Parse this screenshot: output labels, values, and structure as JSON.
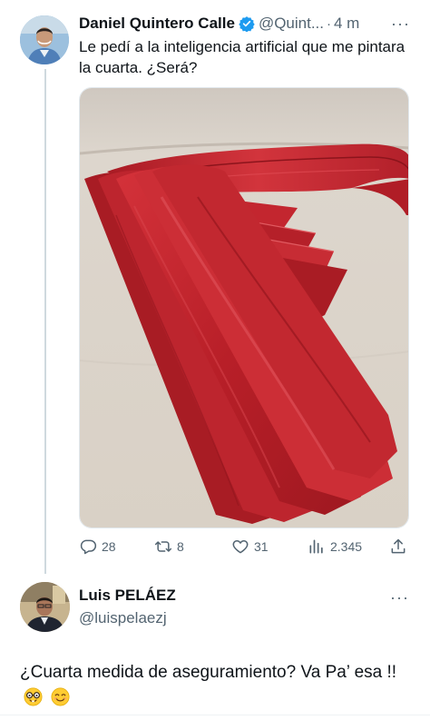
{
  "tweet1": {
    "author_name": "Daniel Quintero Calle",
    "handle": "@Quint...",
    "separator": "·",
    "time": "4 m",
    "more": "···",
    "text": "Le pedí a la inteligencia artificial que me pintara la cuarta. ¿Será?",
    "media_description": "red-ties-on-fabric",
    "stats": {
      "replies": "28",
      "retweets": "8",
      "likes": "31",
      "views": "2.345"
    }
  },
  "tweet2": {
    "author_name": "Luis PELÁEZ",
    "handle": "@luispelaezj",
    "more": "···",
    "text": "¿Cuarta medida de aseguramiento? Va Pa’ esa !!",
    "emojis": [
      "nerd-face",
      "smiling-face"
    ]
  },
  "colors": {
    "text": "#0f1419",
    "secondary": "#536471",
    "verified": "#1d9bf0",
    "thread_line": "#cfd9de",
    "tie_red": "#c0232c"
  }
}
